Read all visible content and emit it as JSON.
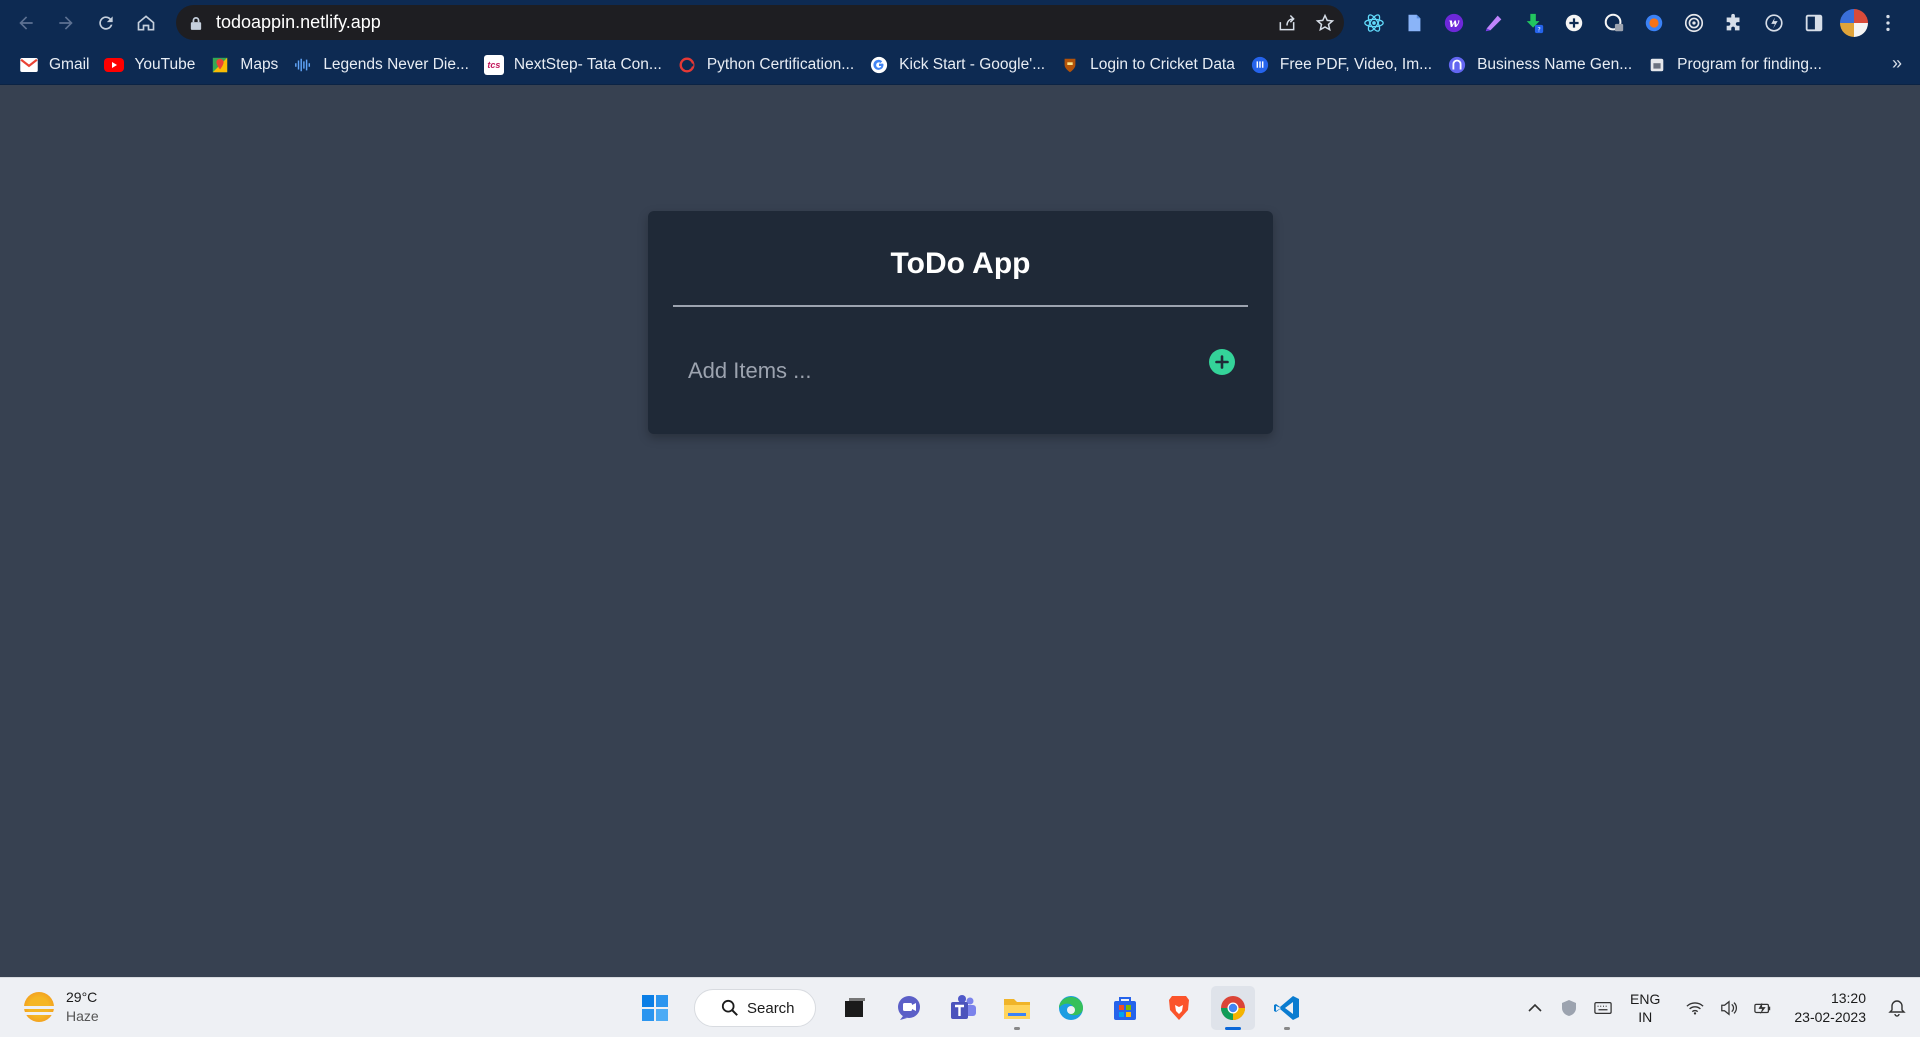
{
  "browser": {
    "url": "todoappin.netlify.app",
    "bookmarks": [
      {
        "label": "Gmail",
        "icon": "gmail-icon"
      },
      {
        "label": "YouTube",
        "icon": "youtube-icon"
      },
      {
        "label": "Maps",
        "icon": "maps-icon"
      },
      {
        "label": "Legends Never Die...",
        "icon": "soundwave-icon"
      },
      {
        "label": "NextStep- Tata Con...",
        "icon": "tcs-icon"
      },
      {
        "label": "Python Certification...",
        "icon": "edureka-icon"
      },
      {
        "label": "Kick Start - Google'...",
        "icon": "google-icon"
      },
      {
        "label": "Login to Cricket Data",
        "icon": "cricket-icon"
      },
      {
        "label": "Free PDF, Video, Im...",
        "icon": "tool-icon"
      },
      {
        "label": "Business Name Gen...",
        "icon": "namegen-icon"
      },
      {
        "label": "Program for finding...",
        "icon": "gfg-icon"
      }
    ],
    "more": "»"
  },
  "app": {
    "title": "ToDo App",
    "input_placeholder": "Add Items ..."
  },
  "taskbar": {
    "weather_temp": "29°C",
    "weather_condition": "Haze",
    "search_label": "Search",
    "language_primary": "ENG",
    "language_secondary": "IN",
    "time": "13:20",
    "date": "23-02-2023"
  },
  "colors": {
    "page_bg": "#374151",
    "card_bg": "#1f2937",
    "add_button": "#34d399",
    "browser_chrome": "#0d2a52"
  }
}
